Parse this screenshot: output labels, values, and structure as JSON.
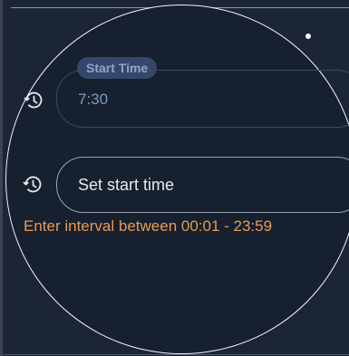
{
  "colors": {
    "background": "#1c2535",
    "face": "#16202e",
    "face_border": "#f2f4f7",
    "label_bg": "#35476b",
    "label_text": "#8fa6cb",
    "value_text": "#7f97c0",
    "hint_text": "#e99b50",
    "placeholder_text": "#e6e9ee"
  },
  "start_time": {
    "label": "Start Time",
    "value": "7:30",
    "icon": "history-icon"
  },
  "set_start": {
    "placeholder": "Set start time",
    "icon": "history-icon"
  },
  "hint": {
    "text": "Enter interval between 00:01 - 23:59"
  }
}
